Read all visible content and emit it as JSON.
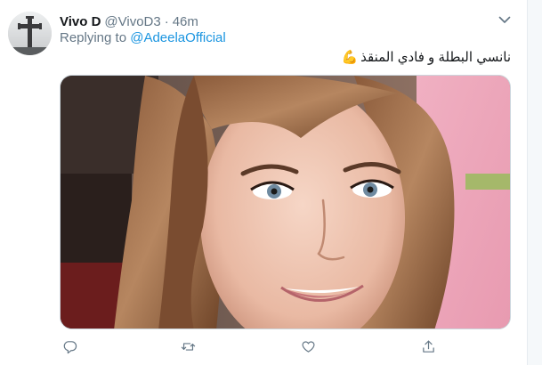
{
  "tweet": {
    "display_name": "Vivo D",
    "handle": "@VivoD3",
    "separator": "·",
    "time": "46m",
    "replying_prefix": "Replying to ",
    "replying_to": "@AdeelaOfficial",
    "text": "نانسي البطلة و فادي المنقذ",
    "emoji": "💪",
    "icons": {
      "avatar": "cross-avatar",
      "more": "chevron-down-icon",
      "reply": "reply-icon",
      "retweet": "retweet-icon",
      "like": "heart-icon",
      "share": "share-icon"
    },
    "colors": {
      "link": "#1b95e0",
      "secondary": "#657786",
      "text": "#14171a"
    }
  }
}
